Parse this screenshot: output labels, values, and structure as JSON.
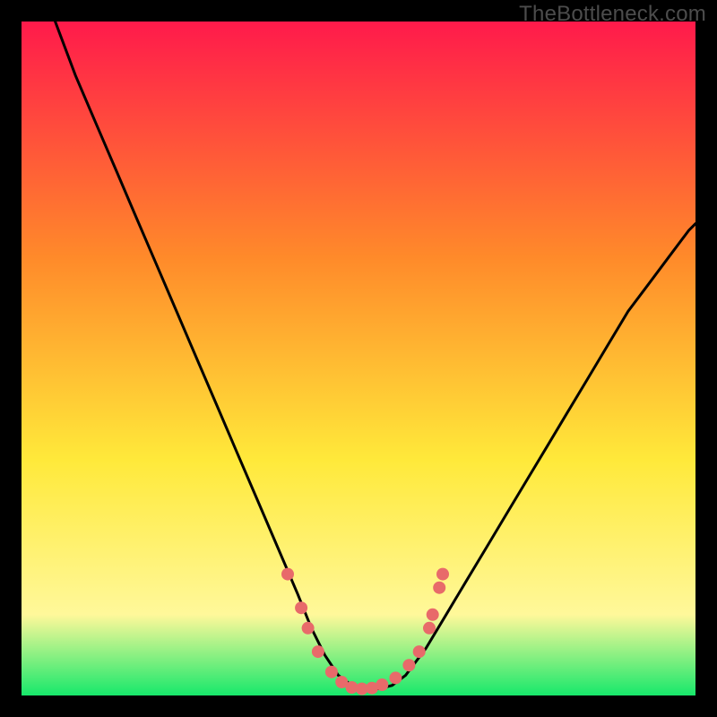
{
  "watermark": "TheBottleneck.com",
  "colors": {
    "bg": "#000000",
    "grad_top": "#ff1a4b",
    "grad_mid1": "#ff8a2a",
    "grad_mid2": "#ffe93a",
    "grad_low": "#fff89a",
    "grad_bottom": "#17e86b",
    "curve": "#000000",
    "marker": "#e86a6a"
  },
  "chart_data": {
    "type": "line",
    "title": "",
    "xlabel": "",
    "ylabel": "",
    "xlim": [
      0,
      100
    ],
    "ylim": [
      0,
      100
    ],
    "legend": null,
    "series": [
      {
        "name": "curve",
        "x": [
          0,
          2,
          5,
          8,
          11,
          14,
          17,
          20,
          23,
          26,
          29,
          32,
          35,
          38,
          41,
          43,
          45,
          47,
          49,
          51,
          53,
          55,
          57,
          60,
          63,
          66,
          69,
          72,
          75,
          78,
          81,
          84,
          87,
          90,
          93,
          96,
          99,
          100
        ],
        "y": [
          125,
          110,
          100,
          92,
          85,
          78,
          71,
          64,
          57,
          50,
          43,
          36,
          29,
          22,
          15,
          10,
          6,
          3,
          1.5,
          1,
          1,
          1.5,
          3,
          7,
          12,
          17,
          22,
          27,
          32,
          37,
          42,
          47,
          52,
          57,
          61,
          65,
          69,
          70
        ]
      }
    ],
    "markers": [
      {
        "x": 39.5,
        "y": 18
      },
      {
        "x": 41.5,
        "y": 13
      },
      {
        "x": 42.5,
        "y": 10
      },
      {
        "x": 44,
        "y": 6.5
      },
      {
        "x": 46,
        "y": 3.5
      },
      {
        "x": 47.5,
        "y": 2
      },
      {
        "x": 49,
        "y": 1.2
      },
      {
        "x": 50.5,
        "y": 1
      },
      {
        "x": 52,
        "y": 1.1
      },
      {
        "x": 53.5,
        "y": 1.6
      },
      {
        "x": 55.5,
        "y": 2.6
      },
      {
        "x": 57.5,
        "y": 4.5
      },
      {
        "x": 59,
        "y": 6.5
      },
      {
        "x": 60.5,
        "y": 10
      },
      {
        "x": 61,
        "y": 12
      },
      {
        "x": 62,
        "y": 16
      },
      {
        "x": 62.5,
        "y": 18
      }
    ]
  }
}
